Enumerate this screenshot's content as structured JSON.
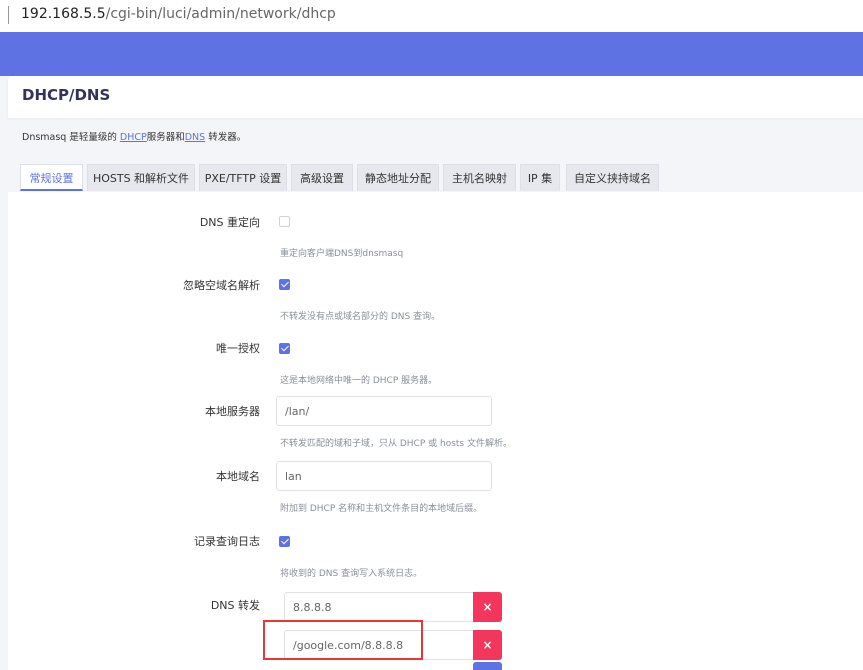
{
  "browser": {
    "url_host": "192.168.5.5",
    "url_path": "/cgi-bin/luci/admin/network/dhcp"
  },
  "page": {
    "title": "DHCP/DNS",
    "desc_prefix": "Dnsmasq 是轻量级的 ",
    "desc_link_dhcp": "DHCP",
    "desc_middle": "服务器和",
    "desc_link_dns": "DNS",
    "desc_suffix": " 转发器。"
  },
  "tabs": [
    {
      "label": "常规设置",
      "active": true
    },
    {
      "label": "HOSTS 和解析文件"
    },
    {
      "label": "PXE/TFTP 设置"
    },
    {
      "label": "高级设置"
    },
    {
      "label": "静态地址分配"
    },
    {
      "label": "主机名映射"
    },
    {
      "label": "IP 集"
    },
    {
      "label": "自定义挟持域名"
    }
  ],
  "fields": {
    "dns_redirect": {
      "label": "DNS 重定向",
      "checked": false,
      "hint": "重定向客户端DNS到dnsmasq"
    },
    "ignore_empty": {
      "label": "忽略空域名解析",
      "checked": true,
      "hint": "不转发没有点或域名部分的 DNS 查询。"
    },
    "authoritative": {
      "label": "唯一授权",
      "checked": true,
      "hint": "这是本地网络中唯一的 DHCP 服务器。"
    },
    "local_server": {
      "label": "本地服务器",
      "value": "/lan/",
      "hint": "不转发匹配的域和子域，只从 DHCP 或 hosts 文件解析。"
    },
    "local_domain": {
      "label": "本地域名",
      "value": "lan",
      "hint": "附加到 DHCP 名称和主机文件条目的本地域后缀。"
    },
    "log_queries": {
      "label": "记录查询日志",
      "checked": true,
      "hint": "将收到的 DNS 查询写入系统日志。"
    },
    "dns_forward": {
      "label": "DNS 转发",
      "values": [
        "8.8.8.8",
        "/google.com/8.8.8.8"
      ],
      "remove_label": "×"
    }
  },
  "colors": {
    "accent": "#5e72e4",
    "danger": "#f5365c",
    "highlight": "#e53935"
  }
}
